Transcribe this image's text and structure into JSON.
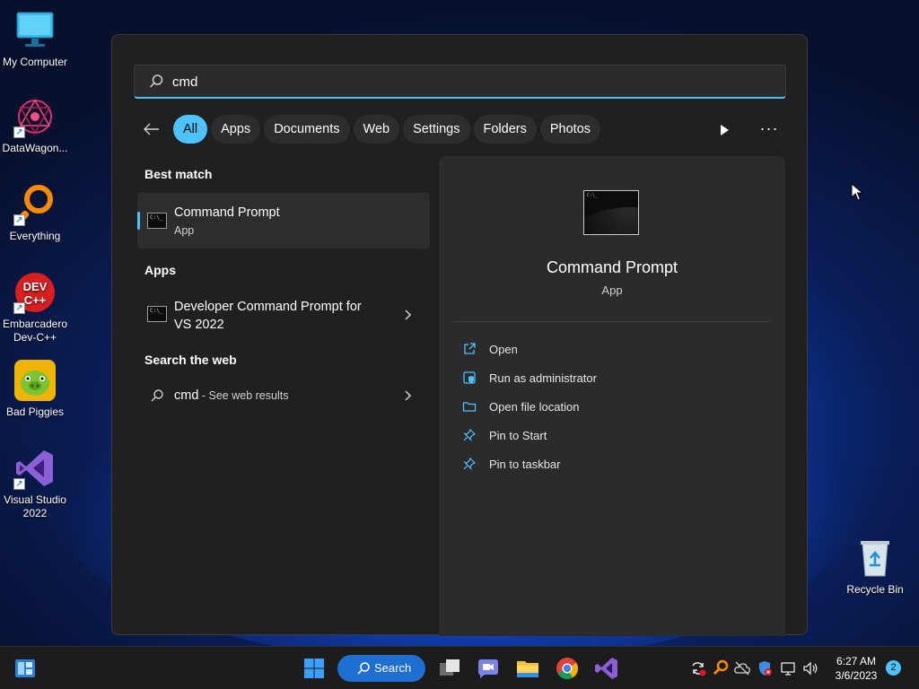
{
  "desktop": {
    "icons": [
      {
        "label": "My Computer"
      },
      {
        "label": "DataWagon..."
      },
      {
        "label": "Everything"
      },
      {
        "label": "Embarcadero Dev-C++"
      },
      {
        "label": "Bad Piggies"
      },
      {
        "label": "Visual Studio 2022"
      }
    ],
    "recycle_bin": {
      "label": "Recycle Bin"
    }
  },
  "search": {
    "query": "cmd",
    "icon": "search-icon",
    "accent": "#4cc2ff"
  },
  "filters": {
    "items": [
      "All",
      "Apps",
      "Documents",
      "Web",
      "Settings",
      "Folders",
      "Photos"
    ],
    "active": "All"
  },
  "results": {
    "best_match_heading": "Best match",
    "best_match": {
      "title": "Command Prompt",
      "subtitle": "App"
    },
    "apps_heading": "Apps",
    "apps": [
      {
        "title_line1": "Developer Command Prompt for",
        "title_line2": "VS 2022"
      }
    ],
    "web_heading": "Search the web",
    "web": {
      "query": "cmd",
      "suffix": " - See web results"
    }
  },
  "preview": {
    "title": "Command Prompt",
    "subtitle": "App",
    "actions": [
      {
        "label": "Open",
        "icon": "open-icon"
      },
      {
        "label": "Run as administrator",
        "icon": "shield-icon"
      },
      {
        "label": "Open file location",
        "icon": "folder-icon"
      },
      {
        "label": "Pin to Start",
        "icon": "pin-icon"
      },
      {
        "label": "Pin to taskbar",
        "icon": "pin-icon"
      }
    ]
  },
  "taskbar": {
    "search_label": "Search",
    "time": "6:27 AM",
    "date": "3/6/2023",
    "notifications": "2"
  }
}
